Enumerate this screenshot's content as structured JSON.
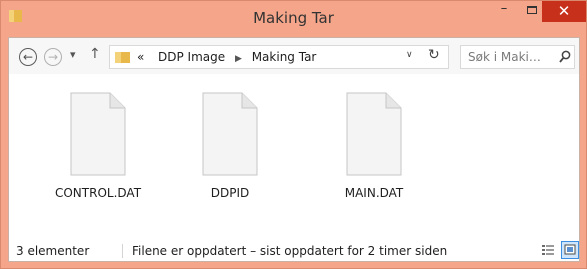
{
  "window": {
    "title": "Making Tar",
    "minimize_glyph": "–",
    "close_glyph": "✕"
  },
  "navigation": {
    "back_glyph": "←",
    "forward_glyph": "→",
    "recent_glyph": "▾",
    "up_glyph": "↑",
    "address": {
      "overflow": "«",
      "crumbs": [
        "DDP Image",
        "Making Tar"
      ],
      "separator": "▶",
      "dropdown_glyph": "∨",
      "refresh_glyph": "↻"
    },
    "search": {
      "placeholder": "Søk i Maki…"
    }
  },
  "files": [
    {
      "name": "CONTROL.DAT",
      "icon": "blank-file-icon"
    },
    {
      "name": "DDPID",
      "icon": "blank-file-icon"
    },
    {
      "name": "MAIN.DAT",
      "icon": "blank-file-icon"
    }
  ],
  "status": {
    "count": "3 elementer",
    "sync": "Filene er oppdatert – sist oppdatert for 2 timer siden"
  },
  "colors": {
    "frame": "#f5a68a",
    "close_button": "#c7311b",
    "folder": "#e8b84a",
    "selected_view": "#cfe5fb"
  }
}
